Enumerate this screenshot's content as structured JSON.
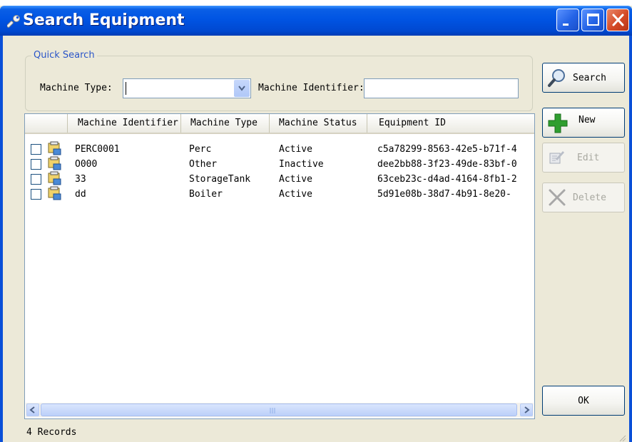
{
  "window": {
    "title": "Search Equipment"
  },
  "quick_search": {
    "legend": "Quick Search",
    "machine_type_label": "Machine Type:",
    "machine_type_value": "",
    "machine_identifier_label": "Machine Identifier:",
    "machine_identifier_value": ""
  },
  "buttons": {
    "search": "Search",
    "new": "New",
    "edit": "Edit",
    "delete": "Delete",
    "ok": "OK"
  },
  "table": {
    "columns": [
      "",
      "Machine Identifier",
      "Machine Type",
      "Machine Status",
      "Equipment ID"
    ],
    "rows": [
      {
        "machine_identifier": "PERC0001",
        "machine_type": "Perc",
        "machine_status": "Active",
        "equipment_id": "c5a78299-8563-42e5-b71f-4"
      },
      {
        "machine_identifier": "O000",
        "machine_type": "Other",
        "machine_status": "Inactive",
        "equipment_id": "dee2bb88-3f23-49de-83bf-0"
      },
      {
        "machine_identifier": "33",
        "machine_type": "StorageTank",
        "machine_status": "Active",
        "equipment_id": "63ceb23c-d4ad-4164-8fb1-2"
      },
      {
        "machine_identifier": "dd",
        "machine_type": "Boiler",
        "machine_status": "Active",
        "equipment_id": "5d91e08b-38d7-4b91-8e20-"
      }
    ]
  },
  "status": {
    "records": "4 Records"
  },
  "colors": {
    "title_bar": "#0054e3",
    "window_bg": "#ece9d8",
    "group_legend": "#2a55c8",
    "new_icon": "#2f9e2f",
    "close_button": "#d44a26"
  }
}
